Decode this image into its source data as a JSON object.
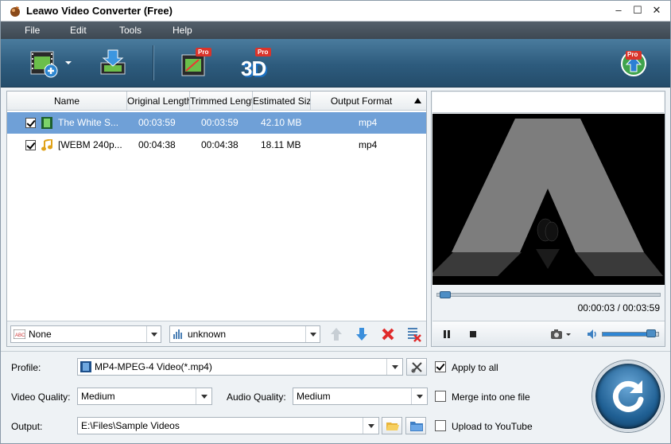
{
  "window": {
    "title": "Leawo Video Converter (Free)"
  },
  "window_controls": {
    "minimize": "–",
    "maximize": "☐",
    "close": "✕"
  },
  "menu": [
    "File",
    "Edit",
    "Tools",
    "Help"
  ],
  "toolbar": {
    "badges": {
      "trim": "Pro",
      "threed_text": "3D",
      "threed": "Pro",
      "upgrade": "Pro"
    }
  },
  "file_list": {
    "columns": [
      "Name",
      "Original Length",
      "Trimmed Length",
      "Estimated Size",
      "Output Format"
    ],
    "rows": [
      {
        "name": "The White S...",
        "original": "00:03:59",
        "trimmed": "00:03:59",
        "size": "42.10 MB",
        "format": "mp4",
        "type": "video",
        "selected": true
      },
      {
        "name": "[WEBM 240p...",
        "original": "00:04:38",
        "trimmed": "00:04:38",
        "size": "18.11 MB",
        "format": "mp4",
        "type": "audio",
        "selected": false
      }
    ],
    "subtitle_select": "None",
    "audio_select": "unknown"
  },
  "preview": {
    "time": "00:00:03 / 00:03:59",
    "seek_progress": 0.013,
    "volume_level": 0.95
  },
  "settings": {
    "profile_label": "Profile:",
    "profile_value": "MP4-MPEG-4 Video(*.mp4)",
    "video_quality_label": "Video Quality:",
    "video_quality_value": "Medium",
    "audio_quality_label": "Audio Quality:",
    "audio_quality_value": "Medium",
    "output_label": "Output:",
    "output_value": "E:\\Files\\Sample Videos",
    "apply_to_all": "Apply to all",
    "merge": "Merge into one file",
    "upload": "Upload to YouTube"
  }
}
